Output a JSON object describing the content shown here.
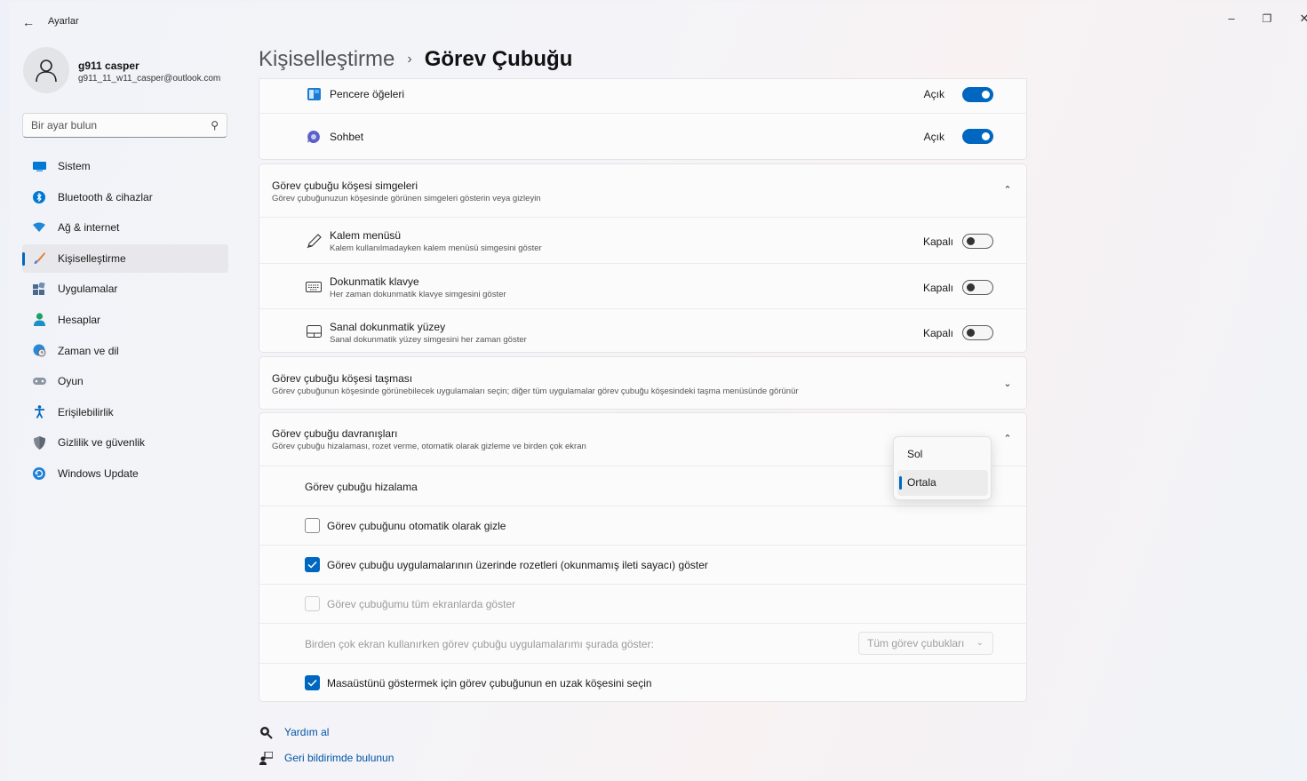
{
  "window": {
    "app_title": "Ayarlar"
  },
  "user": {
    "name": "g911 casper",
    "email": "g911_11_w11_casper@outlook.com"
  },
  "search": {
    "placeholder": "Bir ayar bulun"
  },
  "sidebar": {
    "items": [
      {
        "label": "Sistem",
        "icon": "monitor-icon",
        "active": false
      },
      {
        "label": "Bluetooth & cihazlar",
        "icon": "bluetooth-icon",
        "active": false
      },
      {
        "label": "Ağ & internet",
        "icon": "wifi-icon",
        "active": false
      },
      {
        "label": "Kişiselleştirme",
        "icon": "brush-icon",
        "active": true
      },
      {
        "label": "Uygulamalar",
        "icon": "apps-icon",
        "active": false
      },
      {
        "label": "Hesaplar",
        "icon": "person-icon",
        "active": false
      },
      {
        "label": "Zaman ve dil",
        "icon": "globe-clock-icon",
        "active": false
      },
      {
        "label": "Oyun",
        "icon": "gamepad-icon",
        "active": false
      },
      {
        "label": "Erişilebilirlik",
        "icon": "accessibility-icon",
        "active": false
      },
      {
        "label": "Gizlilik ve güvenlik",
        "icon": "shield-icon",
        "active": false
      },
      {
        "label": "Windows Update",
        "icon": "update-icon",
        "active": false
      }
    ]
  },
  "header": {
    "parent": "Kişiselleştirme",
    "separator": "›",
    "current": "Görev Çubuğu"
  },
  "taskbar_items": {
    "rows": [
      {
        "label": "Pencere öğeleri",
        "state": "Açık",
        "on": true
      },
      {
        "label": "Sohbet",
        "state": "Açık",
        "on": true
      }
    ]
  },
  "corner_icons": {
    "title": "Görev çubuğu köşesi simgeleri",
    "desc": "Görev çubuğunuzun köşesinde görünen simgeleri gösterin veya gizleyin",
    "rows": [
      {
        "title": "Kalem menüsü",
        "desc": "Kalem kullanılmadayken kalem menüsü simgesini göster",
        "state": "Kapalı",
        "on": false
      },
      {
        "title": "Dokunmatik klavye",
        "desc": "Her zaman dokunmatik klavye simgesini göster",
        "state": "Kapalı",
        "on": false
      },
      {
        "title": "Sanal dokunmatik yüzey",
        "desc": "Sanal dokunmatik yüzey simgesini her zaman göster",
        "state": "Kapalı",
        "on": false
      }
    ]
  },
  "overflow": {
    "title": "Görev çubuğu köşesi taşması",
    "desc": "Görev çubuğunun köşesinde görünebilecek uygulamaları seçin; diğer tüm uygulamalar görev çubuğu köşesindeki taşma menüsünde görünür"
  },
  "behaviors": {
    "title": "Görev çubuğu davranışları",
    "desc": "Görev çubuğu hizalaması, rozet verme, otomatik olarak gizleme ve birden çok ekran",
    "alignment_label": "Görev çubuğu hizalama",
    "alignment_options": [
      "Sol",
      "Ortala"
    ],
    "alignment_selected": "Ortala",
    "autohide": {
      "label": "Görev çubuğunu otomatik olarak gizle",
      "checked": false
    },
    "badges": {
      "label": "Görev çubuğu uygulamalarının üzerinde rozetleri (okunmamış ileti sayacı) göster",
      "checked": true
    },
    "all_displays": {
      "label": "Görev çubuğumu tüm ekranlarda göster",
      "checked": false,
      "disabled": true
    },
    "multi_display_label": "Birden çok ekran kullanırken görev çubuğu uygulamalarımı şurada göster:",
    "multi_display_value": "Tüm görev çubukları",
    "far_corner": {
      "label": "Masaüstünü göstermek için görev çubuğunun en uzak köşesini seçin",
      "checked": true
    }
  },
  "footer": {
    "help": "Yardım al",
    "feedback": "Geri bildirimde bulunun"
  },
  "colors": {
    "accent": "#0067c0",
    "link": "#0054a6"
  }
}
